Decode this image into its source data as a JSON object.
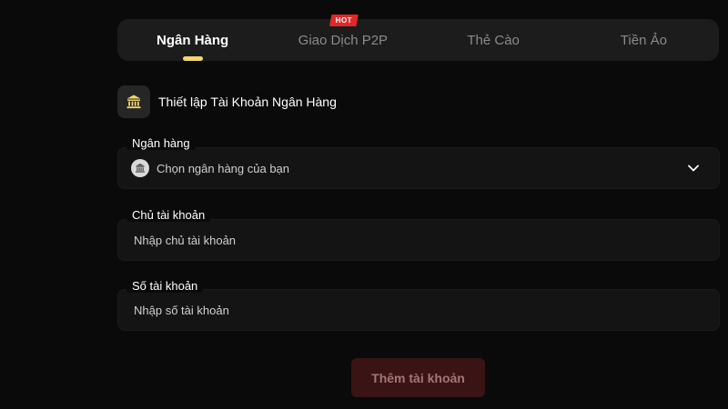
{
  "tabs": [
    {
      "label": "Ngân Hàng",
      "active": true
    },
    {
      "label": "Giao Dịch P2P",
      "badge": "HOT"
    },
    {
      "label": "Thẻ Cào"
    },
    {
      "label": "Tiền Ảo"
    }
  ],
  "section": {
    "title": "Thiết lập Tài Khoản Ngân Hàng",
    "icon": "bank-icon"
  },
  "fields": {
    "bank": {
      "label": "Ngân hàng",
      "placeholder": "Chọn ngân hàng của bạn"
    },
    "owner": {
      "label": "Chủ tài khoản",
      "placeholder": "Nhập chủ tài khoản"
    },
    "account_number": {
      "label": "Số tài khoản",
      "placeholder": "Nhập số tài khoản"
    }
  },
  "submit": {
    "label": "Thêm tài khoản"
  },
  "colors": {
    "accent": "#f2d873",
    "hot_badge": "#e02828",
    "submit_bg": "#3a1414"
  }
}
